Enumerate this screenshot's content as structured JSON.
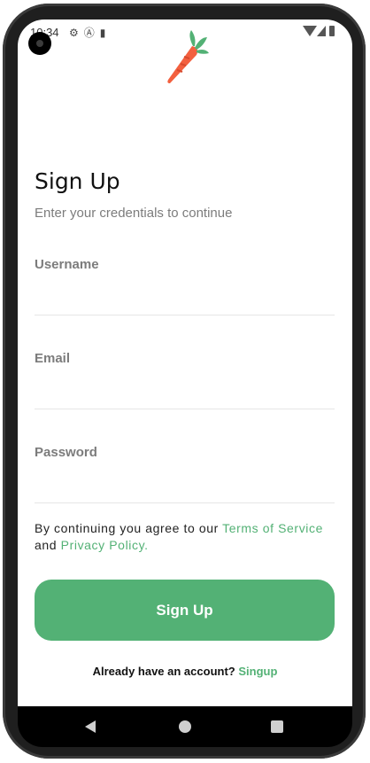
{
  "status_bar": {
    "time": "10:34",
    "icons": [
      "gear-icon",
      "a-icon",
      "sd-card-icon"
    ]
  },
  "brand": {
    "logo": "carrot-logo",
    "accent": "#53b175",
    "logo_color": "#f3603f"
  },
  "header": {
    "title": "Sign Up",
    "subtitle": "Enter your credentials to continue"
  },
  "form": {
    "username": {
      "label": "Username",
      "value": ""
    },
    "email": {
      "label": "Email",
      "value": ""
    },
    "password": {
      "label": "Password",
      "value": ""
    }
  },
  "terms": {
    "prefix": "By continuing you agree to our ",
    "terms_link": "Terms of Service",
    "middle": " and ",
    "privacy_link": "Privacy Policy."
  },
  "actions": {
    "signup_label": "Sign Up"
  },
  "footer": {
    "prompt": "Already have an account? ",
    "link": "Singup"
  }
}
